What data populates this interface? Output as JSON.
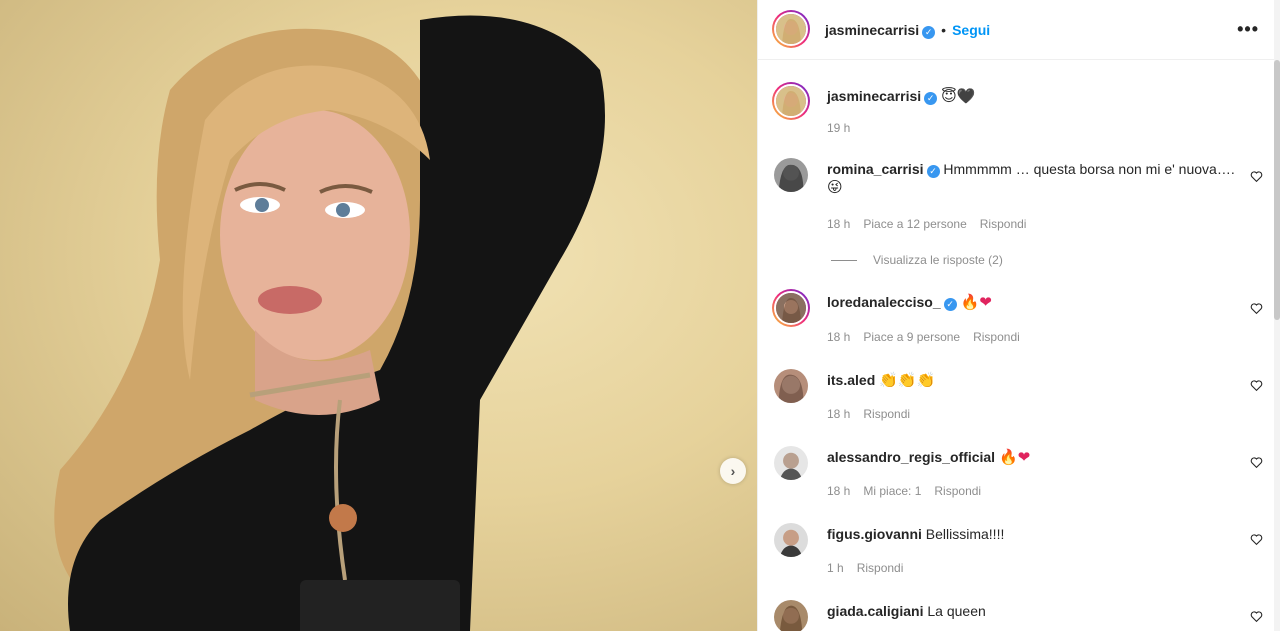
{
  "post": {
    "author": "jasminecarrisi",
    "follow_label": "Segui",
    "more_label": "•••",
    "caption_emojis": [
      "😇",
      "🖤"
    ],
    "caption_time": "19 h",
    "next_icon": "›"
  },
  "comments": [
    {
      "username": "romina_carrisi",
      "verified": true,
      "text": "Hmmmmm … questa borsa non mi e' nuova….",
      "emoji_line": "😜",
      "time": "18 h",
      "likes": "Piace a 12 persone",
      "reply": "Rispondi",
      "view_replies": "Visualizza le risposte (2)"
    },
    {
      "username": "loredanalecciso_",
      "verified": true,
      "text": "🔥❤",
      "time": "18 h",
      "likes": "Piace a 9 persone",
      "reply": "Rispondi"
    },
    {
      "username": "its.aled",
      "verified": false,
      "text": "👏👏👏",
      "time": "18 h",
      "reply": "Rispondi"
    },
    {
      "username": "alessandro_regis_official",
      "verified": false,
      "text": "🔥❤",
      "time": "18 h",
      "likes": "Mi piace: 1",
      "reply": "Rispondi"
    },
    {
      "username": "figus.giovanni",
      "verified": false,
      "text": "Bellissima!!!!",
      "time": "1 h",
      "reply": "Rispondi"
    },
    {
      "username": "giada.caligiani",
      "verified": false,
      "text": "La queen"
    }
  ],
  "colors": {
    "accent": "#0095f6",
    "verified": "#3897f0",
    "muted": "#8e8e8e",
    "photo_bg": "#e6d29b"
  }
}
